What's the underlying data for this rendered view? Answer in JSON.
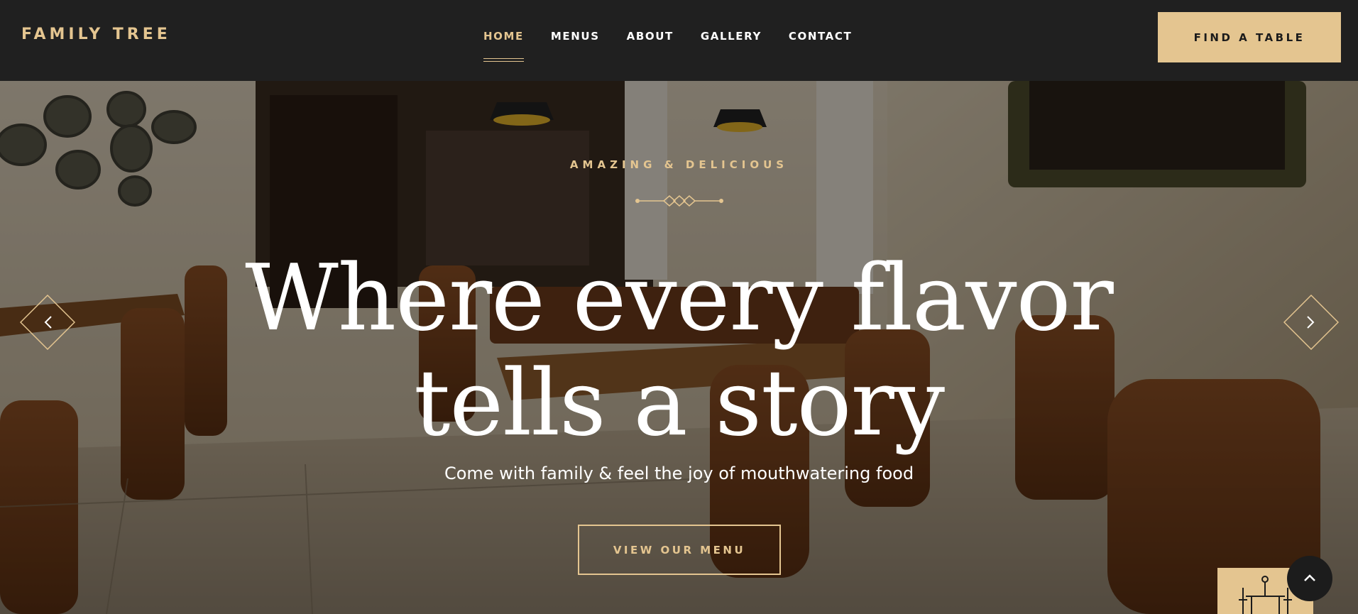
{
  "brand": {
    "name": "FAMILY TREE",
    "accent_color": "#e4c590",
    "header_bg": "#202020"
  },
  "nav": {
    "items": [
      {
        "label": "HOME",
        "active": true
      },
      {
        "label": "MENUS",
        "active": false
      },
      {
        "label": "ABOUT",
        "active": false
      },
      {
        "label": "GALLERY",
        "active": false
      },
      {
        "label": "CONTACT",
        "active": false
      }
    ],
    "cta_label": "FIND A TABLE"
  },
  "hero": {
    "eyebrow": "AMAZING & DELICIOUS",
    "headline_line1": "Where every flavor",
    "headline_line2": "tells a story",
    "tagline": "Come with family & feel the joy of mouthwatering food",
    "button_label": "VIEW OUR MENU",
    "prev_icon": "chevron-left-icon",
    "next_icon": "chevron-right-icon"
  },
  "floating": {
    "back_to_top_icon": "chevron-up-icon",
    "badge_icon": "dining-table-icon"
  }
}
